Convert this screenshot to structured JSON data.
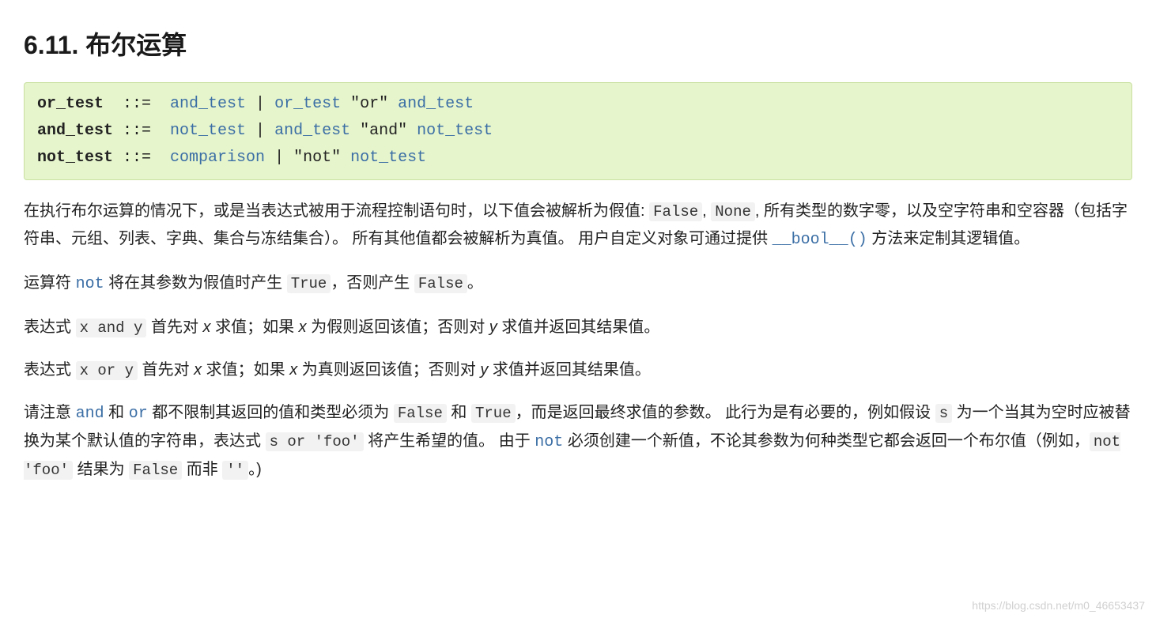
{
  "heading": "6.11. 布尔运算",
  "grammar": {
    "line1": {
      "def": "or_test ",
      "sep": " ::=  ",
      "r1": "and_test",
      "bar": " | ",
      "r2": "or_test",
      "lit": " \"or\" ",
      "r3": "and_test"
    },
    "line2": {
      "def": "and_test",
      "sep": " ::=  ",
      "r1": "not_test",
      "bar": " | ",
      "r2": "and_test",
      "lit": " \"and\" ",
      "r3": "not_test"
    },
    "line3": {
      "def": "not_test",
      "sep": " ::=  ",
      "r1": "comparison",
      "bar": " | ",
      "lit": "\"not\" ",
      "r3": "not_test"
    }
  },
  "para1": {
    "t1": "在执行布尔运算的情况下，或是当表达式被用于流程控制语句时，以下值会被解析为假值: ",
    "c1": "False",
    "t2": ", ",
    "c2": "None",
    "t3": ", 所有类型的数字零，以及空字符串和空容器（包括字符串、元组、列表、字典、集合与冻结集合）。 所有其他值都会被解析为真值。 用户自定义对象可通过提供 ",
    "link": "__bool__()",
    "t4": " 方法来定制其逻辑值。"
  },
  "para2": {
    "t1": "运算符 ",
    "kw": "not",
    "t2": " 将在其参数为假值时产生 ",
    "c1": "True",
    "t3": "，否则产生 ",
    "c2": "False",
    "t4": "。"
  },
  "para3": {
    "t1": "表达式 ",
    "c1": "x and y",
    "t2": " 首先对 ",
    "v1": "x",
    "t3": " 求值；如果 ",
    "v2": "x",
    "t4": " 为假则返回该值；否则对 ",
    "v3": "y",
    "t5": " 求值并返回其结果值。"
  },
  "para4": {
    "t1": "表达式 ",
    "c1": "x or y",
    "t2": " 首先对 ",
    "v1": "x",
    "t3": " 求值；如果 ",
    "v2": "x",
    "t4": " 为真则返回该值；否则对 ",
    "v3": "y",
    "t5": " 求值并返回其结果值。"
  },
  "para5": {
    "t1": "请注意 ",
    "kw1": "and",
    "t2": " 和 ",
    "kw2": "or",
    "t3": " 都不限制其返回的值和类型必须为 ",
    "c1": "False",
    "t4": " 和 ",
    "c2": "True",
    "t5": "，而是返回最终求值的参数。 此行为是有必要的，例如假设 ",
    "c3": "s",
    "t6": " 为一个当其为空时应被替换为某个默认值的字符串，表达式 ",
    "c4": "s or 'foo'",
    "t7": " 将产生希望的值。 由于 ",
    "kw3": "not",
    "t8": " 必须创建一个新值，不论其参数为何种类型它都会返回一个布尔值（例如，",
    "c5": "not 'foo'",
    "t9": " 结果为 ",
    "c6": "False",
    "t10": " 而非 ",
    "c7": "''",
    "t11": "。)"
  },
  "watermark": "https://blog.csdn.net/m0_46653437"
}
